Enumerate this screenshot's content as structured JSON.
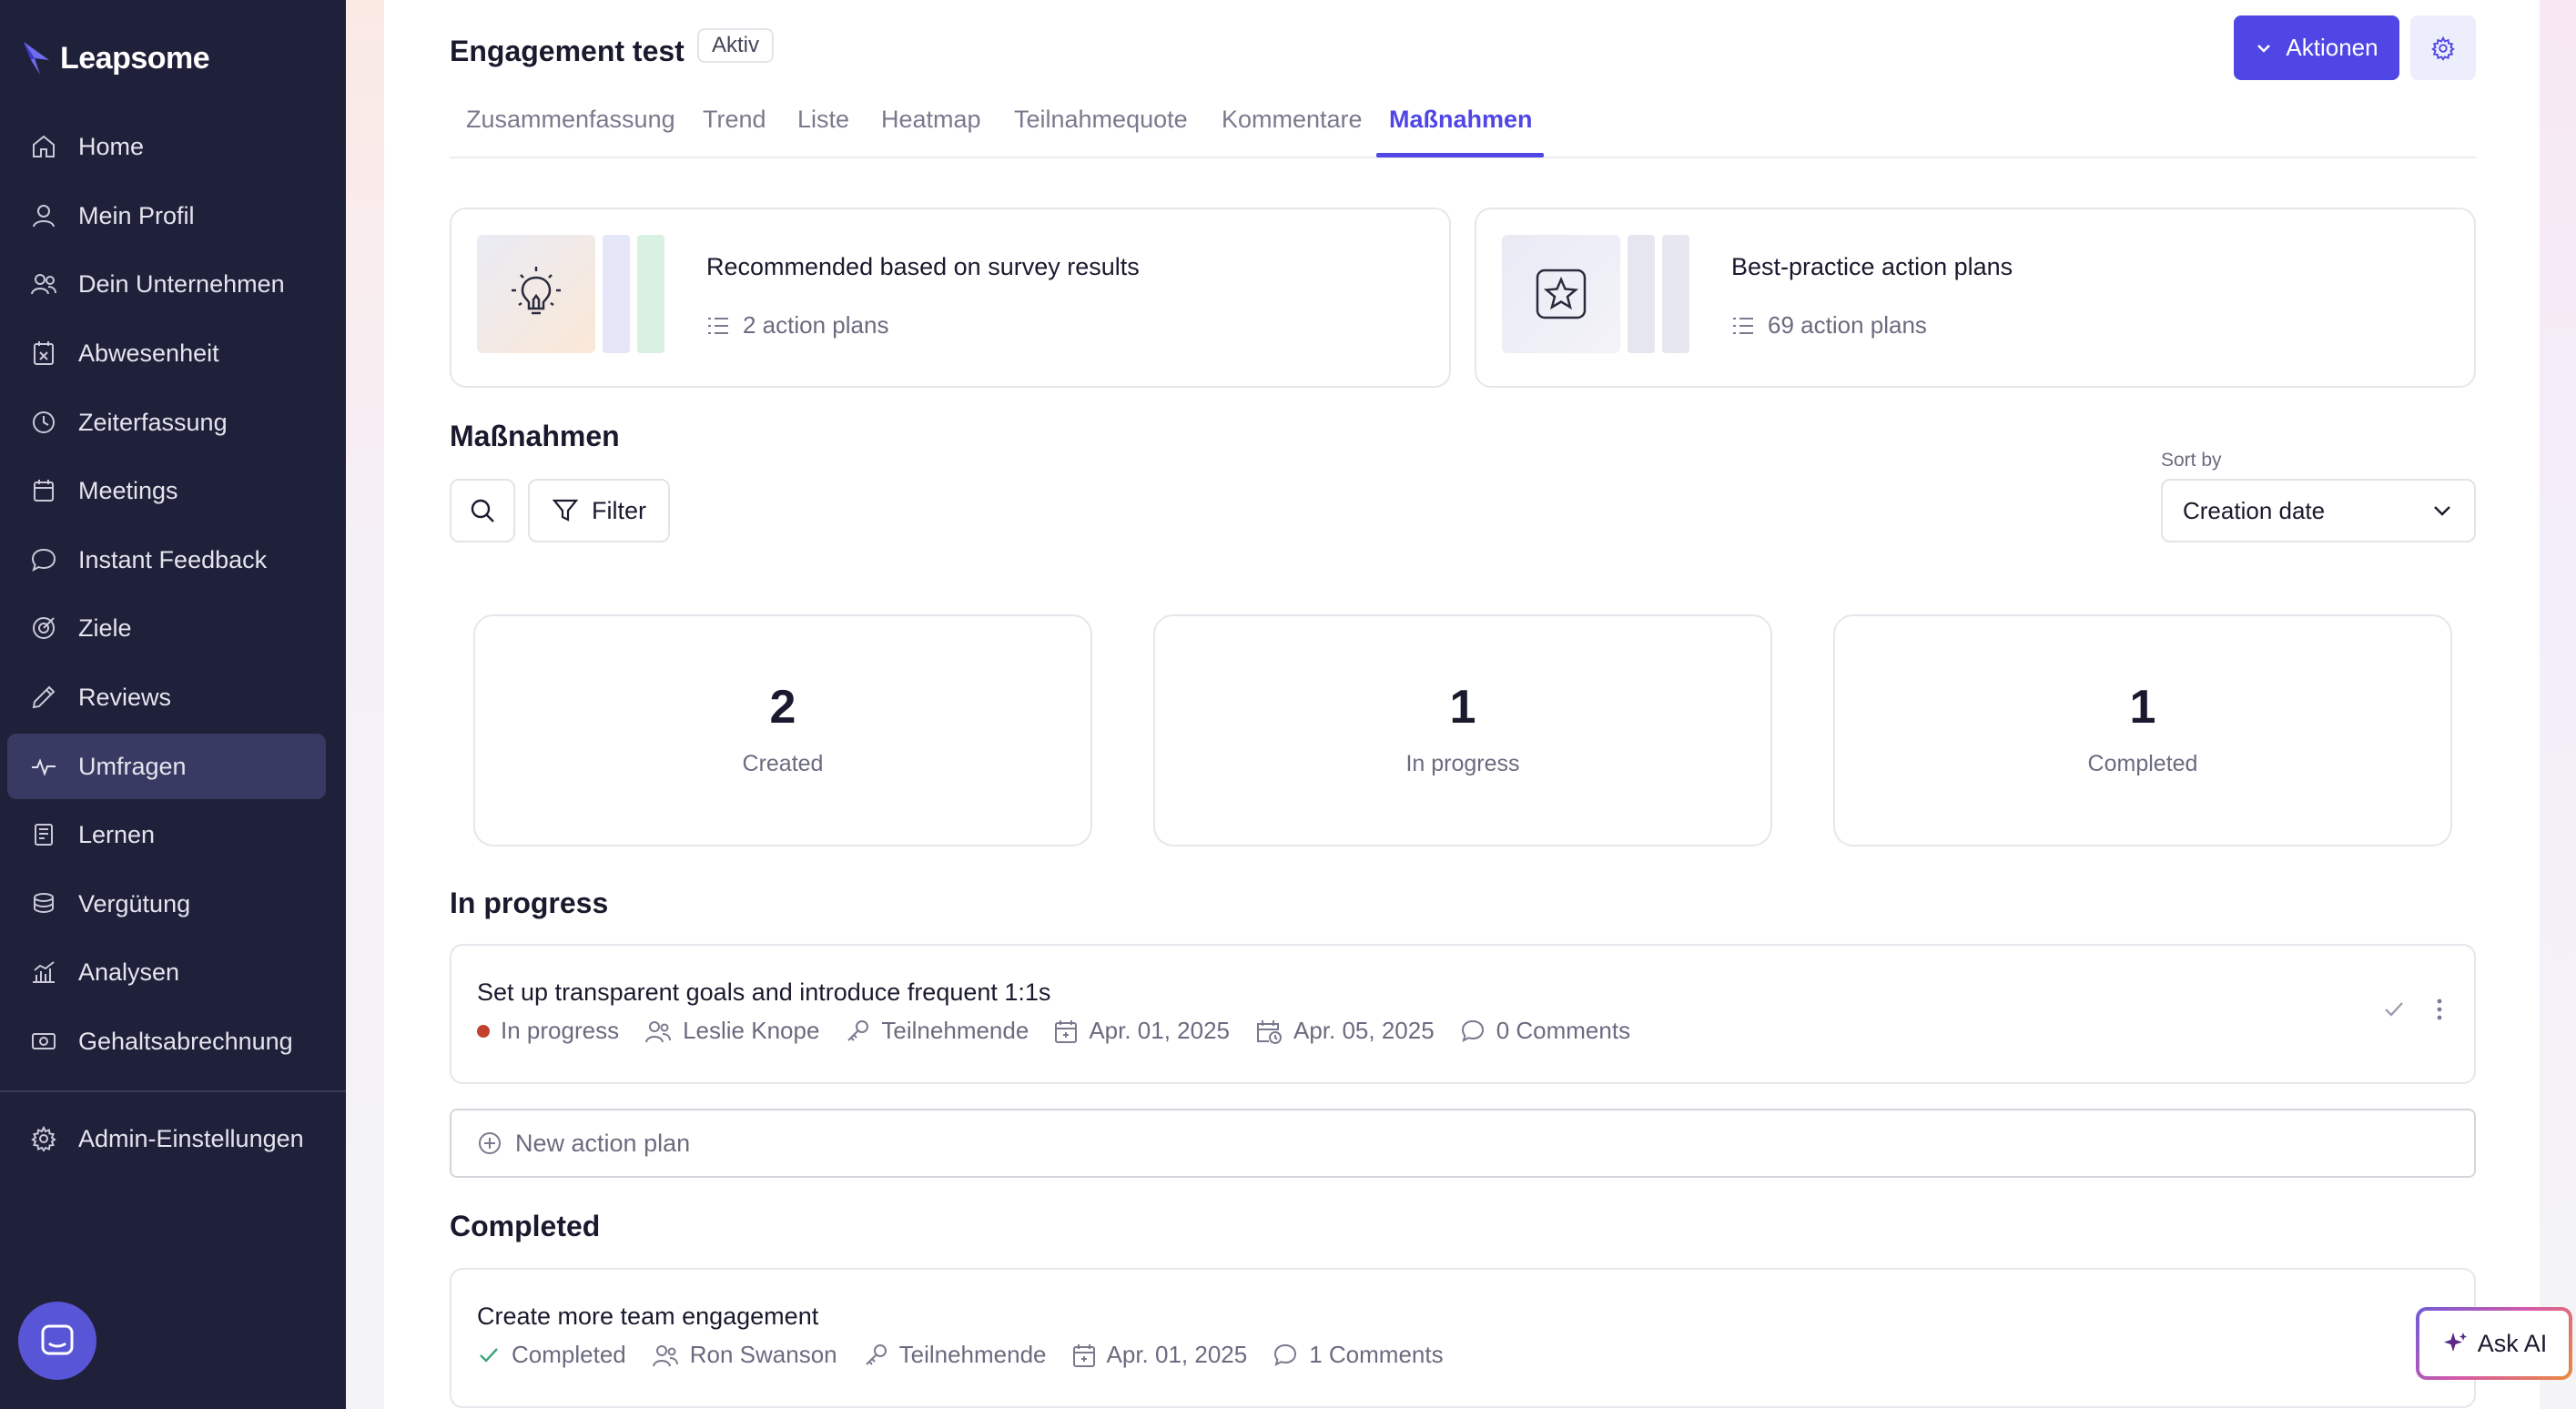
{
  "app": {
    "name": "Leapsome"
  },
  "sidebar": {
    "items": [
      {
        "label": "Home",
        "icon": "home-icon"
      },
      {
        "label": "Mein Profil",
        "icon": "user-icon"
      },
      {
        "label": "Dein Unternehmen",
        "icon": "users-icon"
      },
      {
        "label": "Abwesenheit",
        "icon": "calendar-x-icon"
      },
      {
        "label": "Zeiterfassung",
        "icon": "clock-icon"
      },
      {
        "label": "Meetings",
        "icon": "calendar-icon"
      },
      {
        "label": "Instant Feedback",
        "icon": "chat-icon"
      },
      {
        "label": "Ziele",
        "icon": "target-icon"
      },
      {
        "label": "Reviews",
        "icon": "pencil-icon"
      },
      {
        "label": "Umfragen",
        "icon": "pulse-icon",
        "active": true
      },
      {
        "label": "Lernen",
        "icon": "book-icon"
      },
      {
        "label": "Vergütung",
        "icon": "coins-icon"
      },
      {
        "label": "Analysen",
        "icon": "chart-icon"
      },
      {
        "label": "Gehaltsabrechnung",
        "icon": "money-icon"
      }
    ],
    "admin": {
      "label": "Admin-Einstellungen",
      "icon": "gear-icon"
    }
  },
  "header": {
    "title": "Engagement test",
    "status": "Aktiv",
    "actions_label": "Aktionen"
  },
  "tabs": [
    {
      "label": "Zusammenfassung"
    },
    {
      "label": "Trend"
    },
    {
      "label": "Liste"
    },
    {
      "label": "Heatmap"
    },
    {
      "label": "Teilnahmequote"
    },
    {
      "label": "Kommentare"
    },
    {
      "label": "Maßnahmen",
      "active": true
    }
  ],
  "promos": [
    {
      "title": "Recommended based on survey results",
      "subtitle": "2 action plans"
    },
    {
      "title": "Best-practice action plans",
      "subtitle": "69 action plans"
    }
  ],
  "measures": {
    "section_title": "Maßnahmen",
    "filter_label": "Filter",
    "sort_label": "Sort by",
    "sort_value": "Creation date"
  },
  "stats": [
    {
      "value": "2",
      "label": "Created"
    },
    {
      "value": "1",
      "label": "In progress"
    },
    {
      "value": "1",
      "label": "Completed"
    }
  ],
  "in_progress": {
    "section_title": "In progress",
    "plans": [
      {
        "title": "Set up transparent goals and introduce frequent 1:1s",
        "status": "In progress",
        "owner": "Leslie Knope",
        "audience": "Teilnehmende",
        "start_date": "Apr. 01, 2025",
        "due_date": "Apr. 05, 2025",
        "comments": "0 Comments"
      }
    ],
    "new_plan_label": "New action plan"
  },
  "completed": {
    "section_title": "Completed",
    "plans": [
      {
        "title": "Create more team engagement",
        "status": "Completed",
        "owner": "Ron Swanson",
        "audience": "Teilnehmende",
        "start_date": "Apr. 01, 2025",
        "comments": "1 Comments"
      }
    ]
  },
  "ask_ai": {
    "label": "Ask AI"
  },
  "colors": {
    "sidebar_bg": "#1f2039",
    "sidebar_active": "#393a63",
    "accent": "#4f46e5",
    "in_progress_dot": "#c2412d"
  }
}
